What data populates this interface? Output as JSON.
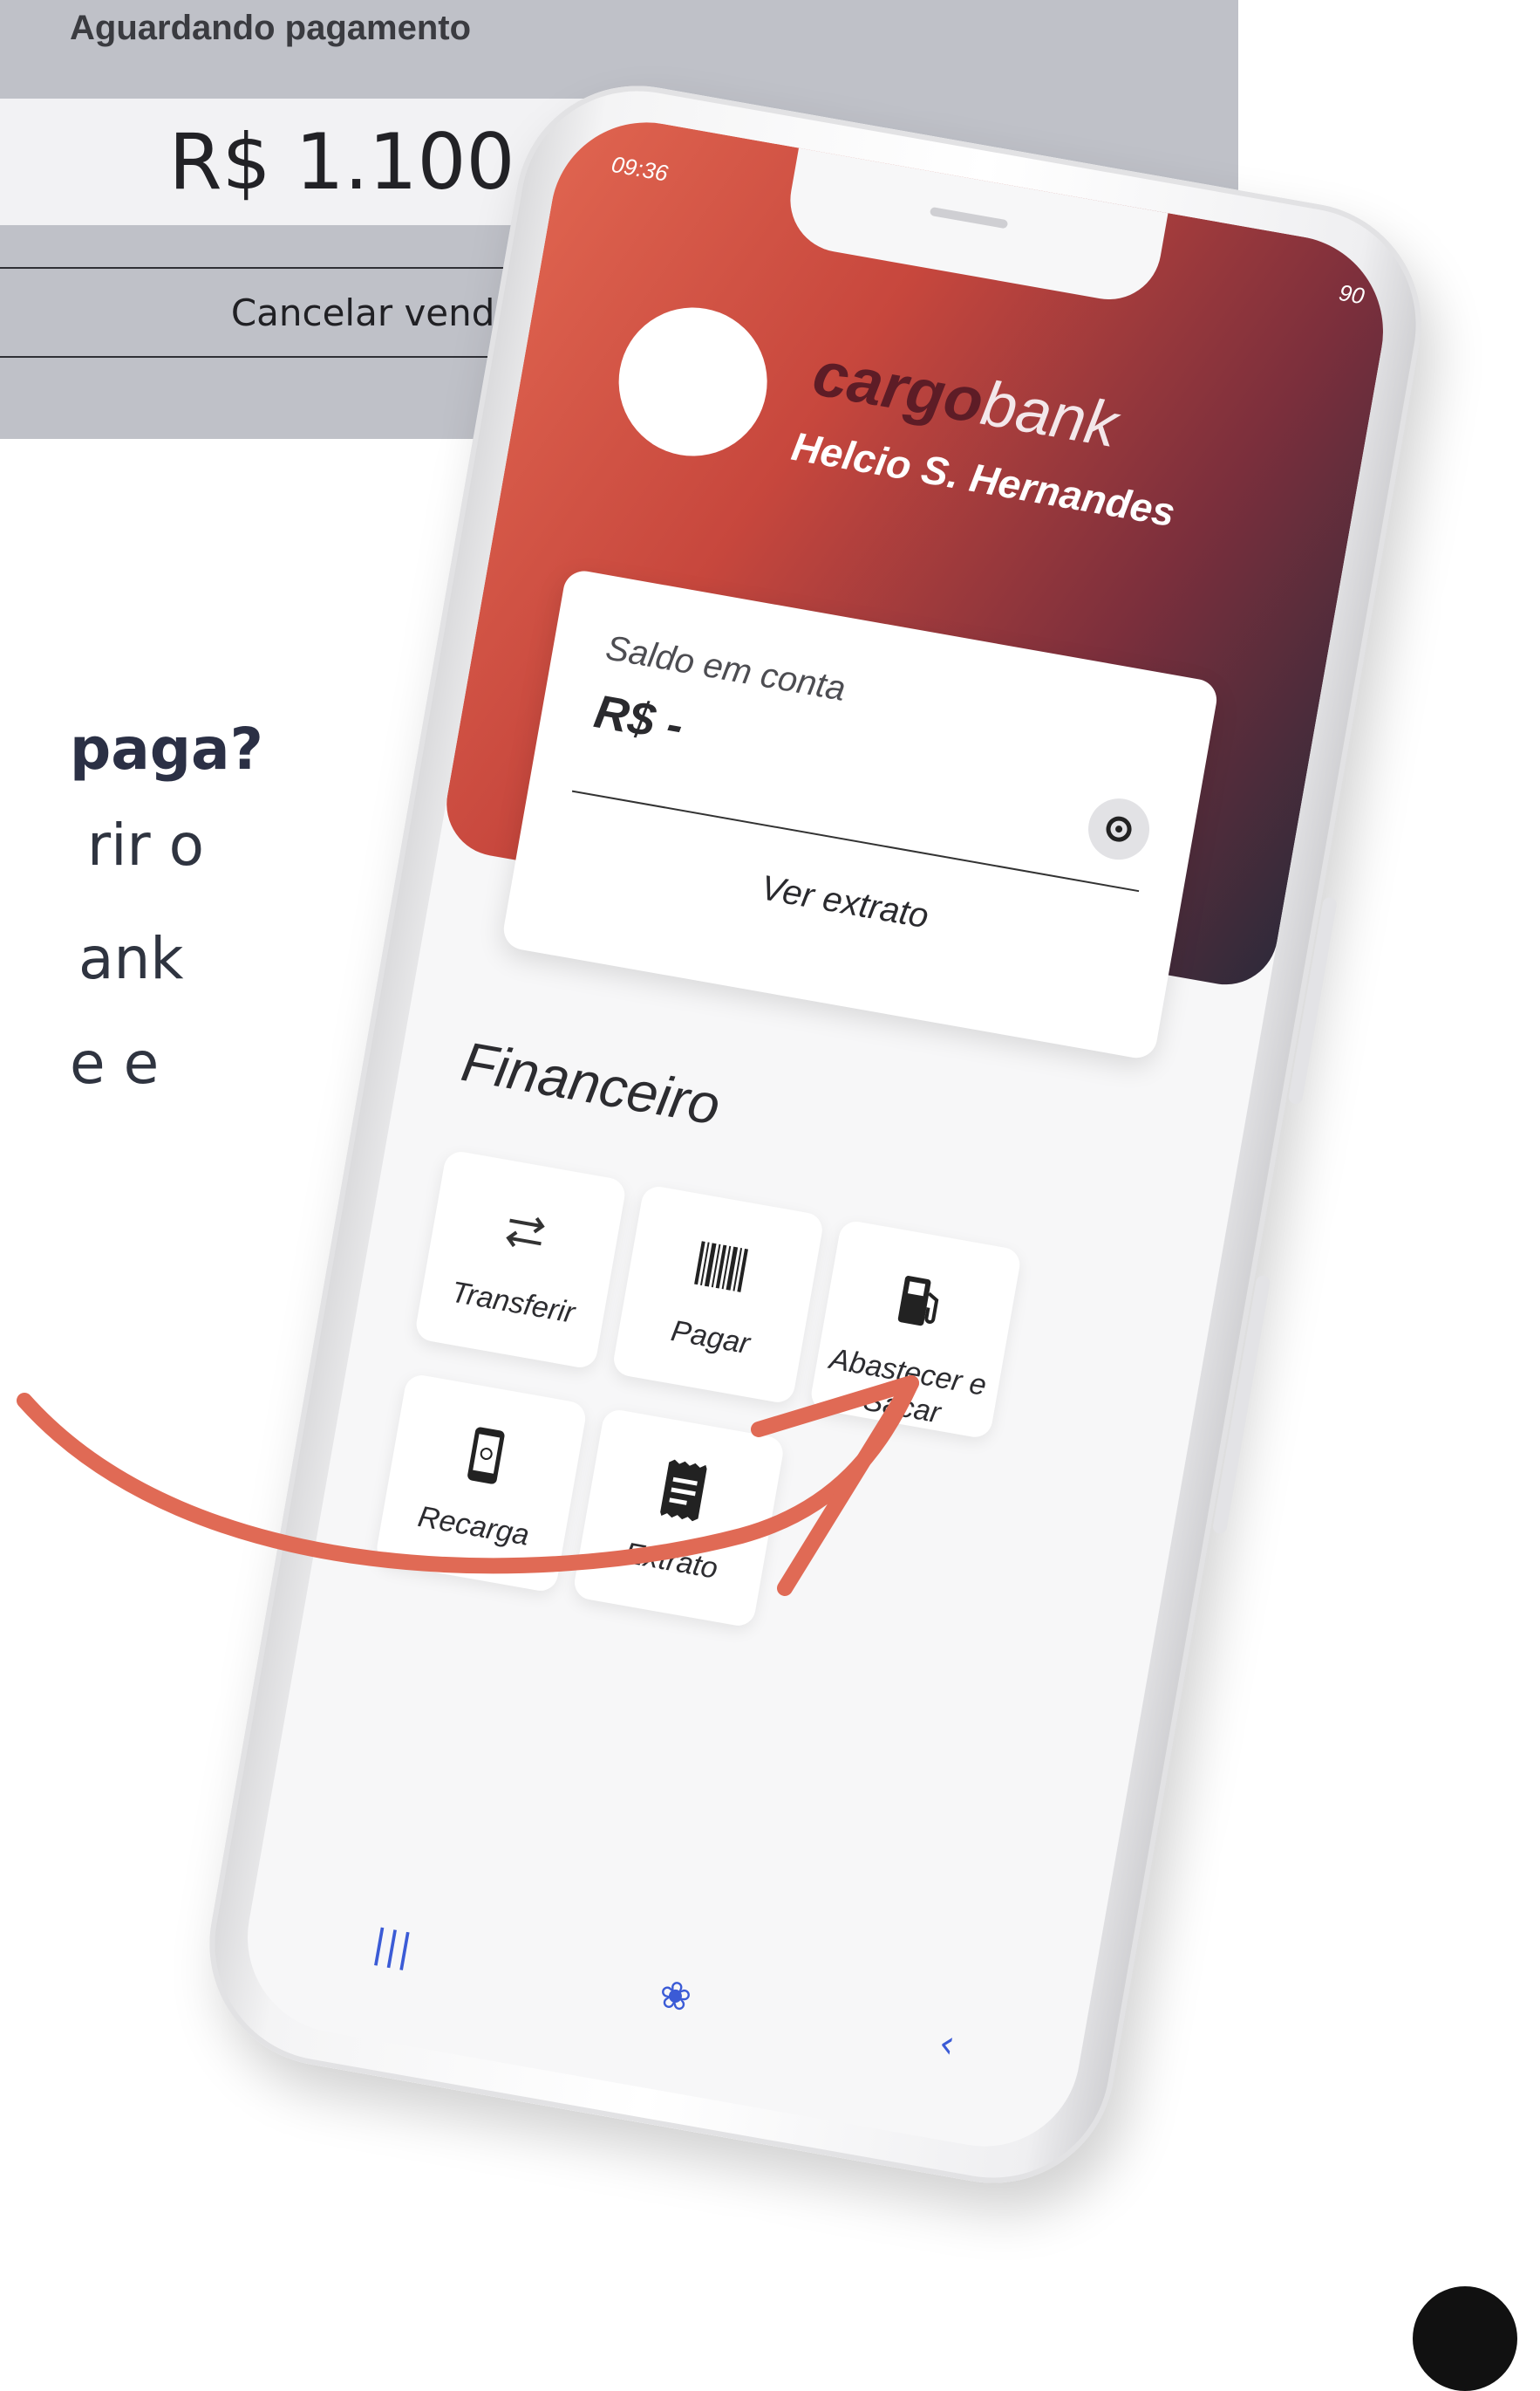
{
  "pos": {
    "status": "Aguardando pagamento",
    "amount": "R$ 1.100,00",
    "cancel_label": "Cancelar venda"
  },
  "left_text": {
    "line1": "paga?",
    "line2": "rir o",
    "line3": "ank",
    "line4": "e e"
  },
  "phone": {
    "status_bar": {
      "time": "09:36",
      "right": "90"
    },
    "brand_bold": "cargo",
    "brand_light": "bank",
    "username": "Helcio S. Hernandes",
    "balance": {
      "label": "Saldo em conta",
      "value": "R$ -",
      "statement_link": "Ver extrato"
    },
    "section_title": "Financeiro",
    "tiles": [
      {
        "label": "Transferir",
        "icon": "transfer-icon"
      },
      {
        "label": "Pagar",
        "icon": "barcode-icon"
      },
      {
        "label": "Abastecer e Sacar",
        "icon": "fuel-pump-icon"
      },
      {
        "label": "Recarga",
        "icon": "phone-recharge-icon"
      },
      {
        "label": "Extrato",
        "icon": "receipt-icon"
      }
    ],
    "nav": {
      "recent": "|||",
      "home": "❀",
      "back": "‹"
    }
  },
  "colors": {
    "accent_red": "#e06550",
    "header_dark": "#2d2a3a",
    "nav_blue": "#3b5bd6",
    "arrow_color": "#e06a55"
  }
}
